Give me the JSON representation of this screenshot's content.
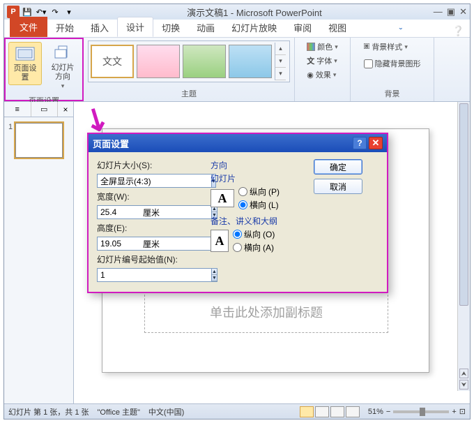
{
  "title": "演示文稿1 - Microsoft PowerPoint",
  "tabs": {
    "file": "文件",
    "home": "开始",
    "insert": "插入",
    "design": "设计",
    "transitions": "切换",
    "animations": "动画",
    "slideshow": "幻灯片放映",
    "review": "审阅",
    "view": "视图"
  },
  "ribbon": {
    "page_setup_group": "页面设置",
    "page_setup_btn": "页面设置",
    "slide_orientation_btn": "幻灯片方向",
    "themes_group": "主题",
    "sample_theme_text": "文文",
    "colors": "颜色",
    "fonts": "字体",
    "effects": "效果",
    "bg_group": "背景",
    "bg_styles": "背景样式",
    "hide_bg_graphics": "隐藏背景图形"
  },
  "panel": {
    "tab_outline": "≡",
    "tab_thumbs": "▭",
    "close": "×",
    "slide1_num": "1"
  },
  "slide": {
    "subtitle_ph": "单击此处添加副标题"
  },
  "dialog": {
    "title": "页面设置",
    "slide_size_label": "幻灯片大小(S):",
    "slide_size_value": "全屏显示(4:3)",
    "width_label": "宽度(W):",
    "width_value": "25.4",
    "height_label": "高度(E):",
    "height_value": "19.05",
    "unit": "厘米",
    "number_from_label": "幻灯片编号起始值(N):",
    "number_from_value": "1",
    "orientation_title": "方向",
    "slides_title": "幻灯片",
    "notes_title": "备注、讲义和大纲",
    "portrait": "纵向",
    "landscape": "横向",
    "portrait_key": "(P)",
    "landscape_key": "(L)",
    "portrait_key2": "(O)",
    "landscape_key2": "(A)",
    "ok": "确定",
    "cancel": "取消"
  },
  "status": {
    "slide_info": "幻灯片 第 1 张，共 1 张",
    "theme": "\"Office 主题\"",
    "lang": "中文(中国)",
    "zoom": "51%"
  }
}
